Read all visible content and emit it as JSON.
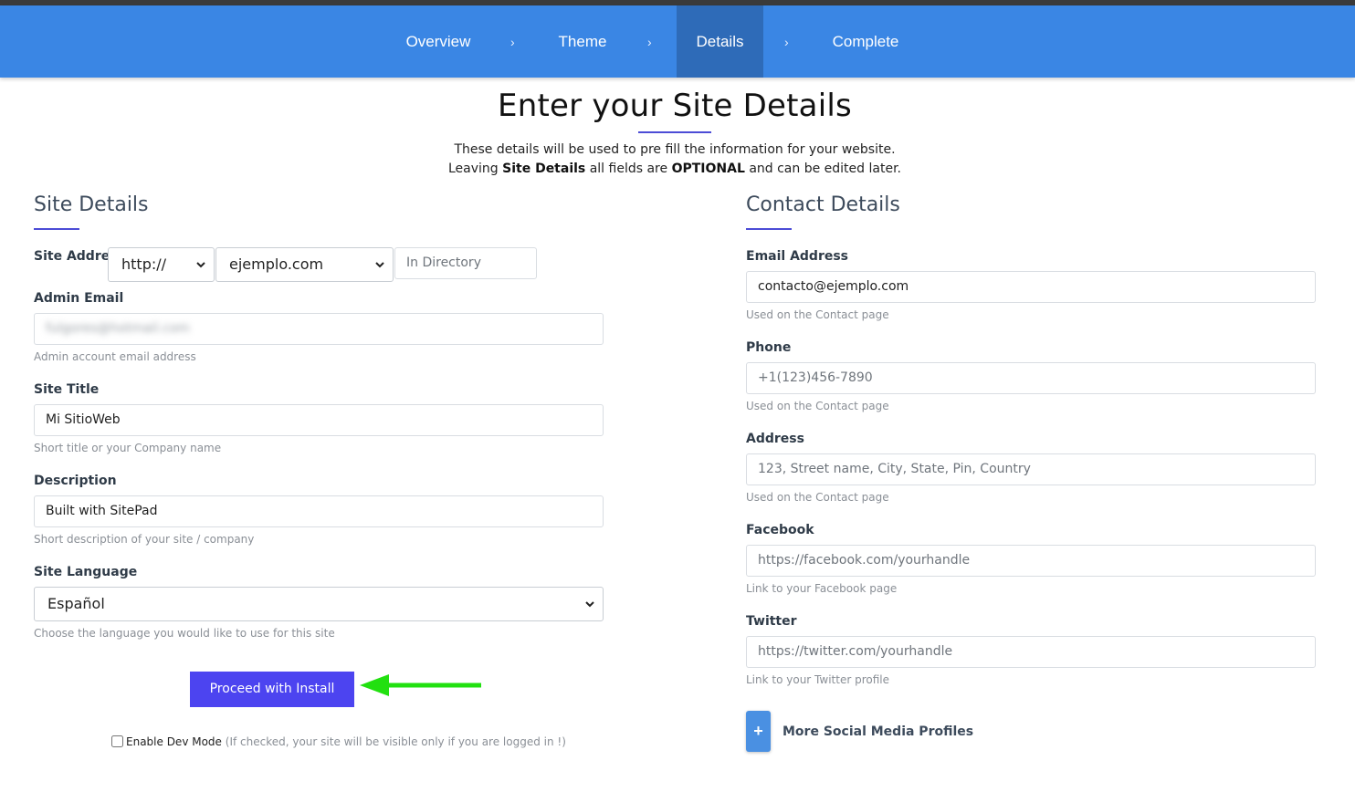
{
  "nav": {
    "items": [
      {
        "label": "Overview"
      },
      {
        "label": "Theme"
      },
      {
        "label": "Details"
      },
      {
        "label": "Complete"
      }
    ],
    "separator": "›",
    "active": "Details"
  },
  "page": {
    "heading": "Enter your Site Details",
    "intro_line1": "These details will be used to pre fill the information for your website.",
    "intro_line2_a": "Leaving ",
    "intro_line2_b": "Site Details",
    "intro_line2_c": " all fields are ",
    "intro_line2_d": "OPTIONAL",
    "intro_line2_e": " and can be edited later."
  },
  "site_details": {
    "title": "Site Details",
    "site_address": {
      "label": "Site Address",
      "protocol": "http://",
      "domain": "ejemplo.com",
      "directory_placeholder": "In Directory"
    },
    "admin_email": {
      "label": "Admin Email",
      "value": "fulgores@hotmail.com",
      "help": "Admin account email address"
    },
    "site_title": {
      "label": "Site Title",
      "value": "Mi SitioWeb",
      "help": "Short title or your Company name"
    },
    "description": {
      "label": "Description",
      "value": "Built with SitePad",
      "help": "Short description of your site / company"
    },
    "site_language": {
      "label": "Site Language",
      "value": "Español",
      "help": "Choose the language you would like to use for this site"
    },
    "proceed_button": "Proceed with Install",
    "dev_mode_label": "Enable Dev Mode",
    "dev_mode_note": "(If checked, your site will be visible only if you are logged in !)"
  },
  "contact_details": {
    "title": "Contact Details",
    "email": {
      "label": "Email Address",
      "value": "contacto@ejemplo.com",
      "help": "Used on the Contact page"
    },
    "phone": {
      "label": "Phone",
      "placeholder": "+1(123)456-7890",
      "help": "Used on the Contact page"
    },
    "address": {
      "label": "Address",
      "placeholder": "123, Street name, City, State, Pin, Country",
      "help": "Used on the Contact page"
    },
    "facebook": {
      "label": "Facebook",
      "placeholder": "https://facebook.com/yourhandle",
      "help": "Link to your Facebook page"
    },
    "twitter": {
      "label": "Twitter",
      "placeholder": "https://twitter.com/yourhandle",
      "help": "Link to your Twitter profile"
    },
    "more_social_button": "+",
    "more_social_label": "More Social Media Profiles"
  },
  "colors": {
    "nav_bg": "#3a86e4",
    "nav_active": "#2e6bb8",
    "accent": "#4c44f0",
    "arrow": "#22e010"
  }
}
